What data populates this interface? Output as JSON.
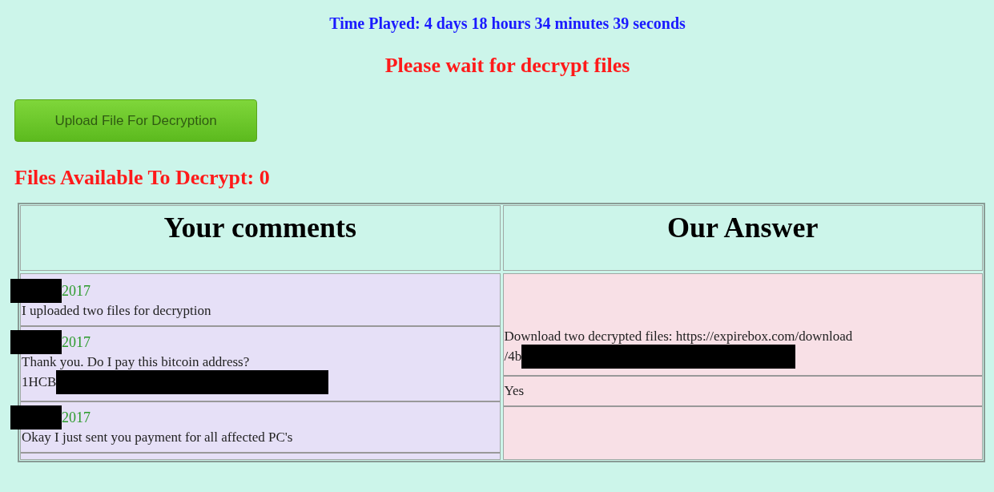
{
  "time_played": "Time Played: 4 days 18 hours 34 minutes 39 seconds",
  "status": "Please wait for decrypt files",
  "upload_button": "Upload File For Decryption",
  "files_available": "Files Available To Decrypt: 0",
  "table": {
    "columns": [
      "Your comments",
      "Our Answer"
    ],
    "comments": [
      {
        "date": "2017",
        "date_redacted": true,
        "lines": [
          {
            "text": "I uploaded two files for decryption",
            "redacted_tail": false
          }
        ]
      },
      {
        "date": "2017",
        "date_redacted": true,
        "lines": [
          {
            "text": "Thank you. Do I pay this bitcoin address?",
            "redacted_tail": false
          },
          {
            "text": "1HCB",
            "redacted_tail": true
          }
        ]
      },
      {
        "date": "2017",
        "date_redacted": true,
        "lines": [
          {
            "text": "Okay I just sent you payment for all affected PC's",
            "redacted_tail": false
          }
        ]
      }
    ],
    "answers": [
      {
        "lines": [
          {
            "text": "Download two decrypted files: https://expirebox.com/download",
            "redacted_tail": false
          },
          {
            "text": "/4b",
            "redacted_tail": true
          }
        ]
      },
      {
        "lines": [
          {
            "text": "Yes",
            "redacted_tail": false
          }
        ]
      }
    ]
  }
}
